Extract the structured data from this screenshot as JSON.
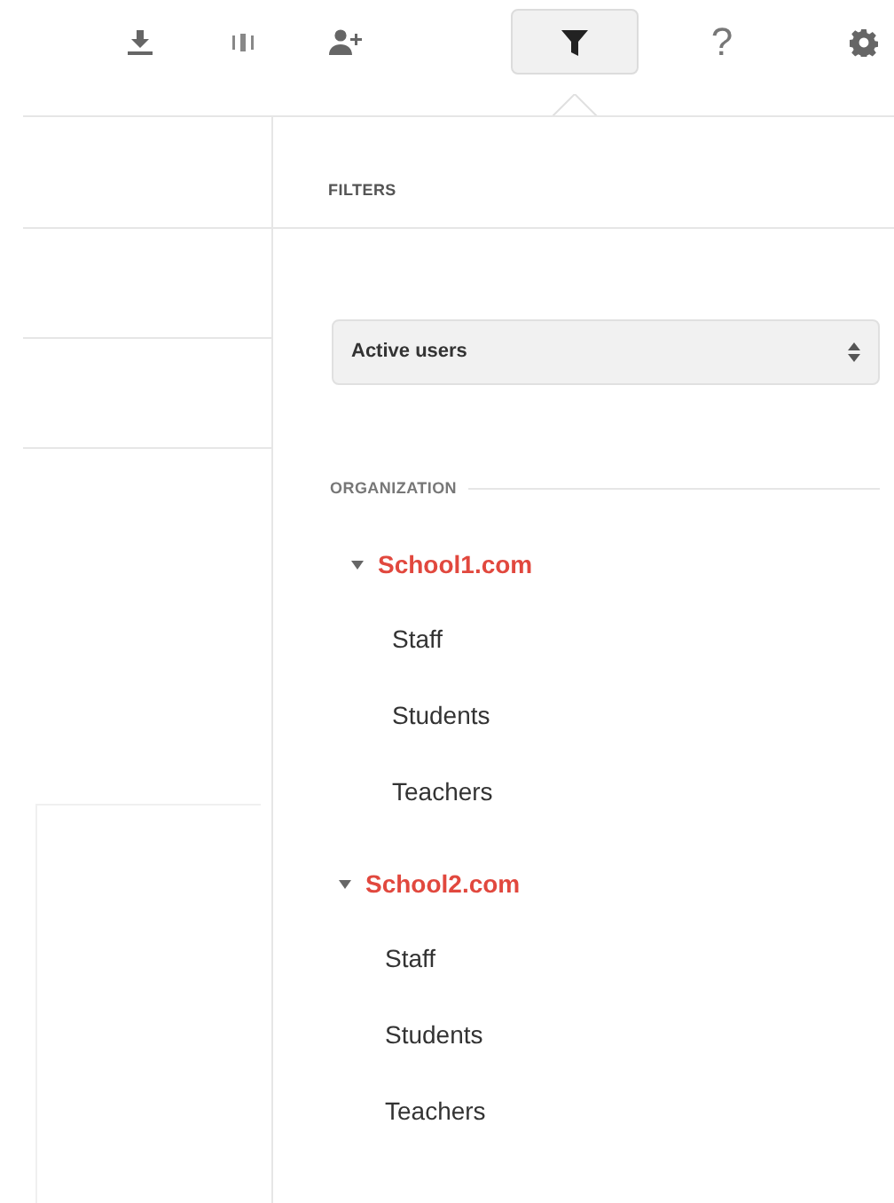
{
  "toolbar": [
    {
      "kind": "download",
      "selected": false
    },
    {
      "kind": "columns",
      "selected": false
    },
    {
      "kind": "add-user",
      "selected": false
    },
    {
      "kind": "filter",
      "selected": true
    },
    {
      "kind": "help",
      "text": "?",
      "selected": false
    },
    {
      "kind": "settings",
      "selected": false
    }
  ],
  "filters": {
    "title": "FILTERS",
    "select": {
      "value": "Active users"
    },
    "section": "ORGANIZATION",
    "tree": [
      {
        "label": "School1.com",
        "expanded": true,
        "children": [
          {
            "label": "Staff"
          },
          {
            "label": "Students"
          },
          {
            "label": "Teachers"
          }
        ]
      },
      {
        "label": "School2.com",
        "expanded": true,
        "children": [
          {
            "label": "Staff"
          },
          {
            "label": "Students"
          },
          {
            "label": "Teachers"
          }
        ]
      }
    ]
  }
}
